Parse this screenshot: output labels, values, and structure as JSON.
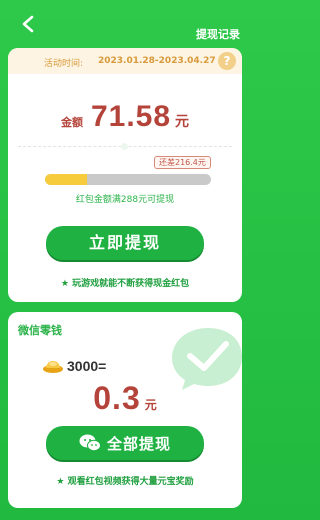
{
  "header": {
    "back_icon": "chevron-left-icon",
    "record_link": "提现记录"
  },
  "activity": {
    "period_label": "活动时间:",
    "period_value": "2023.01.28-2023.04.27",
    "help_icon": "question-icon",
    "help_symbol": "?",
    "amount_label": "金额",
    "amount_value": "71.58",
    "amount_unit": "元",
    "diff_badge": "还差216.4元",
    "progress_fraction": 0.25,
    "hint": "红包金额满288元可提现",
    "withdraw_button": "立即提现",
    "tip": "★ 玩游戏就能不断获得现金红包"
  },
  "wallet": {
    "title": "微信零钱",
    "ingot_icon": "gold-ingot-icon",
    "ingot_count": "3000",
    "equals": "=",
    "cash_value": "0.3",
    "cash_unit": "元",
    "wechat_icon": "wechat-icon",
    "withdraw_all_button": "全部提现",
    "tip": "★ 观看红包视频获得大量元宝奖励"
  },
  "colors": {
    "accent_green": "#1fb142",
    "amount_red": "#b4433a",
    "progress_yellow": "#f6cb3c",
    "period_orange": "#d89a3a"
  }
}
